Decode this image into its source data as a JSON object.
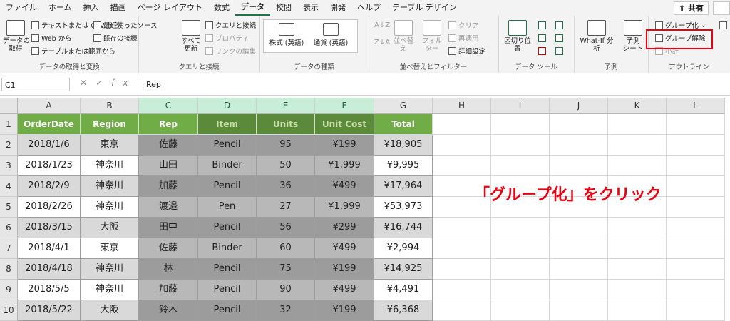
{
  "menu": {
    "items": [
      "ファイル",
      "ホーム",
      "挿入",
      "描画",
      "ページ レイアウト",
      "数式",
      "データ",
      "校閲",
      "表示",
      "開発",
      "ヘルプ",
      "テーブル デザイン"
    ],
    "active": "データ",
    "share": "共有"
  },
  "ribbon": {
    "get_data": {
      "label": "データの取得と変換",
      "big_button": "データの\n取得",
      "items": [
        "テキストまたは CSV から",
        "Web から",
        "テーブルまたは範囲から",
        "最近使ったソース",
        "既存の接続"
      ]
    },
    "queries": {
      "label": "クエリと接続",
      "big_button": "すべて\n更新",
      "items": [
        "クエリと接続",
        "プロパティ",
        "リンクの編集"
      ]
    },
    "data_types": {
      "label": "データの種類",
      "items": [
        "株式 (英語)",
        "通貨 (英語)"
      ]
    },
    "sort_filter": {
      "label": "並べ替えとフィルター",
      "sort": "並べ替え",
      "filter": "フィルター",
      "items": [
        "クリア",
        "再適用",
        "詳細設定"
      ]
    },
    "data_tools": {
      "label": "データ ツール",
      "text_to_columns": "区切り位置"
    },
    "forecast": {
      "label": "予測",
      "what_if": "What-If 分析",
      "forecast_sheet": "予測\nシート"
    },
    "outline": {
      "label": "アウトライン",
      "items": [
        "グループ化",
        "グループ解除",
        "小計"
      ]
    }
  },
  "formula_bar": {
    "name_box": "C1",
    "formula": "Rep"
  },
  "columns": [
    "A",
    "B",
    "C",
    "D",
    "E",
    "F",
    "G",
    "H",
    "I",
    "J",
    "K",
    "L"
  ],
  "rows": [
    "1",
    "2",
    "3",
    "4",
    "5",
    "6",
    "7",
    "8",
    "9",
    "10"
  ],
  "table": {
    "headers": [
      "OrderDate",
      "Region",
      "Rep",
      "Item",
      "Units",
      "Unit Cost",
      "Total"
    ],
    "data": [
      [
        "2018/1/6",
        "東京",
        "佐藤",
        "Pencil",
        "95",
        "¥199",
        "¥18,905"
      ],
      [
        "2018/1/23",
        "神奈川",
        "山田",
        "Binder",
        "50",
        "¥1,999",
        "¥9,995"
      ],
      [
        "2018/2/9",
        "神奈川",
        "加藤",
        "Pencil",
        "36",
        "¥499",
        "¥17,964"
      ],
      [
        "2018/2/26",
        "神奈川",
        "渡邉",
        "Pen",
        "27",
        "¥1,999",
        "¥53,973"
      ],
      [
        "2018/3/15",
        "大阪",
        "田中",
        "Pencil",
        "56",
        "¥299",
        "¥16,744"
      ],
      [
        "2018/4/1",
        "東京",
        "佐藤",
        "Binder",
        "60",
        "¥499",
        "¥2,994"
      ],
      [
        "2018/4/18",
        "神奈川",
        "林",
        "Pencil",
        "75",
        "¥199",
        "¥14,925"
      ],
      [
        "2018/5/5",
        "神奈川",
        "加藤",
        "Pencil",
        "90",
        "¥499",
        "¥4,491"
      ],
      [
        "2018/5/22",
        "大阪",
        "鈴木",
        "Pencil",
        "32",
        "¥199",
        "¥6,368"
      ]
    ]
  },
  "annotation": "「グループ化」をクリック",
  "colors": {
    "header_green": "#70ad47",
    "header_selected": "#5a8a3a",
    "accent_red": "#e60012",
    "excel_green": "#217346"
  }
}
